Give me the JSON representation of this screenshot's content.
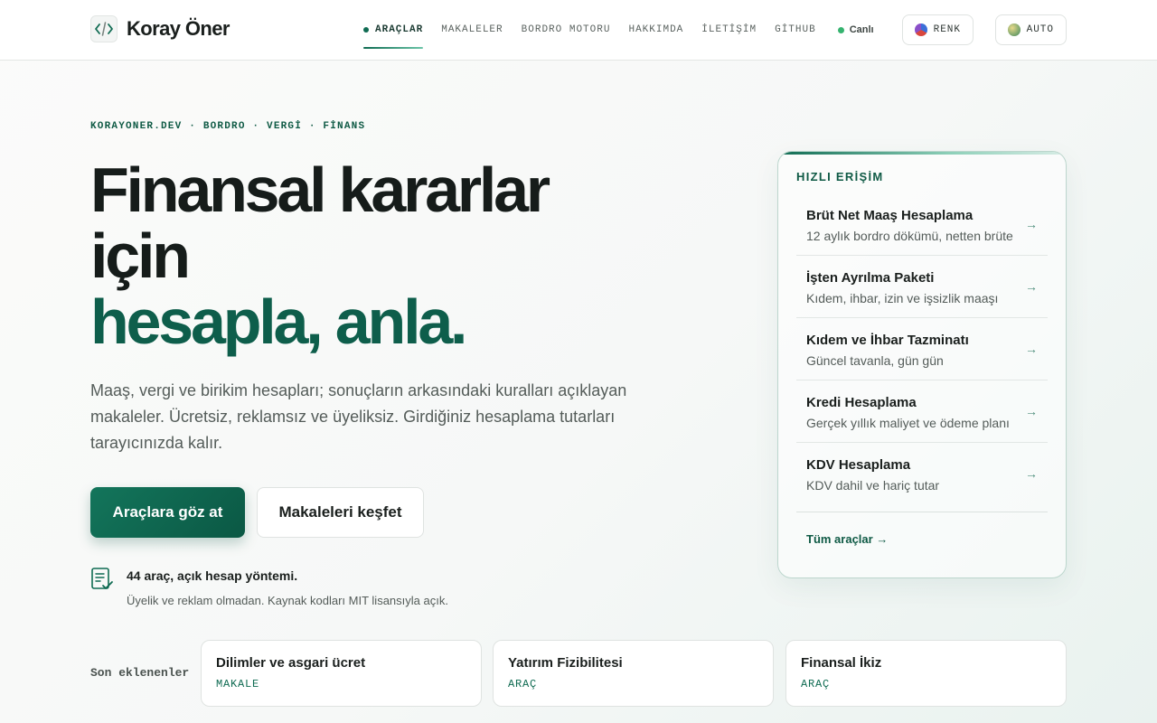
{
  "header": {
    "brand": "Koray Öner",
    "nav": [
      {
        "label": "ARAÇLAR",
        "active": true
      },
      {
        "label": "MAKALELER"
      },
      {
        "label": "BORDRO MOTORU"
      },
      {
        "label": "HAKKIMDA"
      },
      {
        "label": "İLETİŞİM"
      },
      {
        "label": "GİTHUB"
      }
    ],
    "live_label": "Canlı",
    "color_button": "RENK",
    "theme_button": "AUTO"
  },
  "hero": {
    "eyebrow": "KORAYONER.DEV · BORDRO · VERGİ · FİNANS",
    "title_line1": "Finansal kararlar",
    "title_line2": "için",
    "title_accent": "hesapla, anla.",
    "lede": "Maaş, vergi ve birikim hesapları; sonuçların arkasındaki kuralları açıklayan makaleler. Ücretsiz, reklamsız ve üyeliksiz. Girdiğiniz hesaplama tutarları tarayıcınızda kalır.",
    "primary_cta": "Araçlara göz at",
    "secondary_cta": "Makaleleri keşfet",
    "note_title": "44 araç, açık hesap yöntemi.",
    "note_sub": "Üyelik ve reklam olmadan. Kaynak kodları MIT lisansıyla açık."
  },
  "quick_access": {
    "title": "HIZLI ERİŞİM",
    "items": [
      {
        "title": "Brüt Net Maaş Hesaplama",
        "subtitle": "12 aylık bordro dökümü, netten brüte",
        "arrow": "→"
      },
      {
        "title": "İşten Ayrılma Paketi",
        "subtitle": "Kıdem, ihbar, izin ve işsizlik maaşı",
        "arrow": "→"
      },
      {
        "title": "Kıdem ve İhbar Tazminatı",
        "subtitle": "Güncel tavanla, gün gün",
        "arrow": "→"
      },
      {
        "title": "Kredi Hesaplama",
        "subtitle": "Gerçek yıllık maliyet ve ödeme planı",
        "arrow": "→"
      },
      {
        "title": "KDV Hesaplama",
        "subtitle": "KDV dahil ve hariç tutar",
        "arrow": "→"
      }
    ],
    "all_link": "Tüm araçlar →"
  },
  "recent": {
    "label": "Son eklenenler",
    "items": [
      {
        "title": "Dilimler ve asgari ücret",
        "type": "MAKALE"
      },
      {
        "title": "Yatırım Fizibilitesi",
        "type": "ARAÇ"
      },
      {
        "title": "Finansal İkiz",
        "type": "ARAÇ"
      }
    ]
  },
  "colors": {
    "accent": "#0e5e4b",
    "accent_bright": "#13755b",
    "live": "#35b36f"
  }
}
